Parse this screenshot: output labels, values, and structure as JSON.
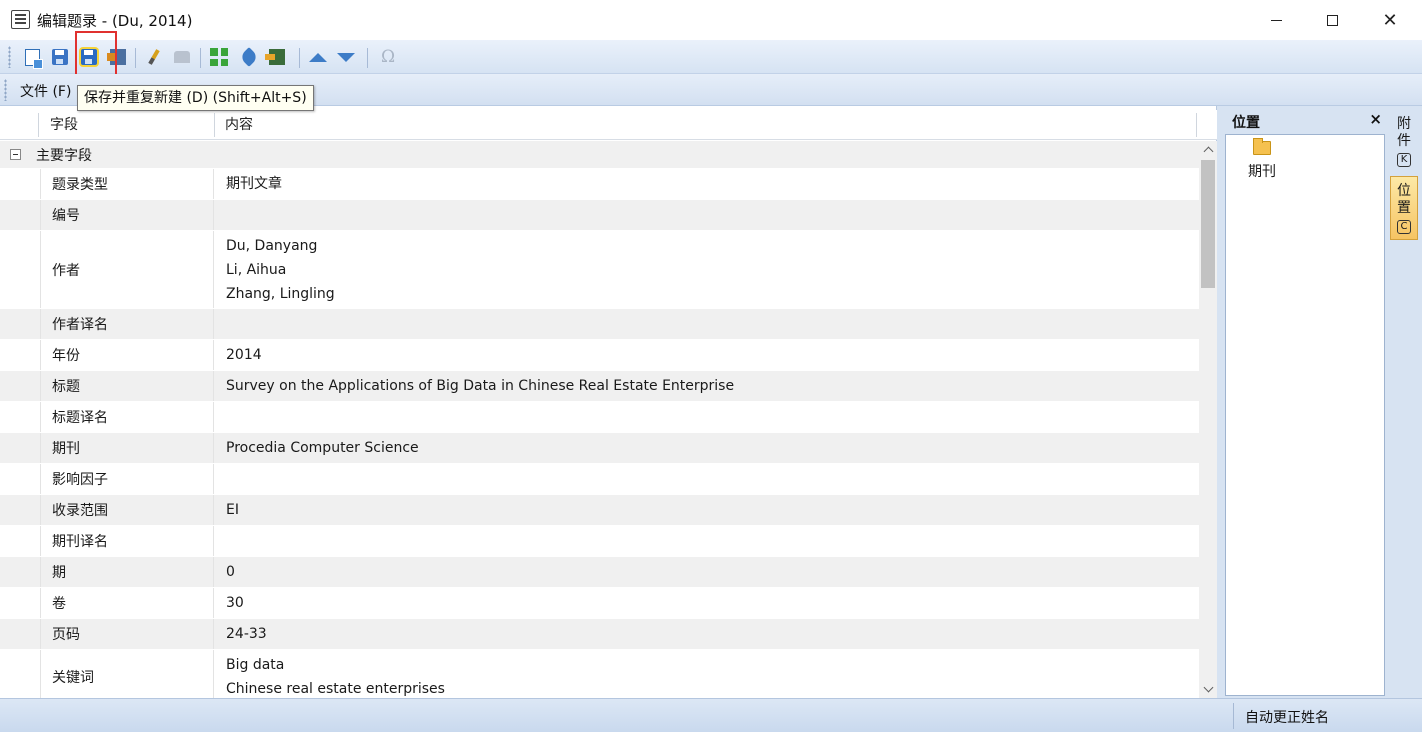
{
  "window": {
    "title": "编辑题录 - (Du, 2014)",
    "minimize_glyph": "",
    "maximize_glyph": "",
    "close_glyph": "✕"
  },
  "toolbar": {
    "buttons": [
      {
        "name": "new-record",
        "icon": "new-document-icon"
      },
      {
        "name": "save",
        "icon": "save-icon"
      },
      {
        "name": "save-and-repeat-new",
        "icon": "save-new-icon",
        "highlighted": true
      },
      {
        "name": "save-and-close",
        "icon": "save-close-icon"
      },
      {
        "name": "clean",
        "icon": "brush-icon"
      },
      {
        "name": "stamp",
        "icon": "stamp-icon",
        "disabled": true
      },
      {
        "name": "fields",
        "icon": "grid-icon"
      },
      {
        "name": "pin",
        "icon": "pin-icon"
      },
      {
        "name": "export",
        "icon": "export-icon"
      },
      {
        "name": "move-up",
        "icon": "arrow-up-icon"
      },
      {
        "name": "move-down",
        "icon": "arrow-down-icon"
      },
      {
        "name": "symbol",
        "icon": "omega-icon",
        "disabled": true
      }
    ],
    "omega": "Ω",
    "tooltip": "保存并重复新建 (D) (Shift+Alt+S)",
    "highlight_color": "#e0312f"
  },
  "menu": {
    "file": "文件 (F)"
  },
  "grid": {
    "headers": {
      "field": "字段",
      "content": "内容"
    },
    "group": "主要字段",
    "rows": [
      {
        "field": "题录类型",
        "value": [
          "期刊文章"
        ]
      },
      {
        "field": "编号",
        "value": []
      },
      {
        "field": "作者",
        "value": [
          "Du, Danyang",
          "Li, Aihua",
          "Zhang, Lingling"
        ]
      },
      {
        "field": "作者译名",
        "value": []
      },
      {
        "field": "年份",
        "value": [
          "2014"
        ]
      },
      {
        "field": "标题",
        "value": [
          "Survey on the Applications of Big Data in Chinese Real Estate Enterprise"
        ]
      },
      {
        "field": "标题译名",
        "value": []
      },
      {
        "field": "期刊",
        "value": [
          "Procedia Computer Science"
        ]
      },
      {
        "field": "影响因子",
        "value": []
      },
      {
        "field": "收录范围",
        "value": [
          "EI"
        ]
      },
      {
        "field": "期刊译名",
        "value": []
      },
      {
        "field": "期",
        "value": [
          "0"
        ]
      },
      {
        "field": "卷",
        "value": [
          "30"
        ]
      },
      {
        "field": "页码",
        "value": [
          "24-33"
        ]
      },
      {
        "field": "关键词",
        "value": [
          "Big data",
          "Chinese real estate enterprises"
        ]
      }
    ]
  },
  "side_panel": {
    "title": "位置",
    "close": "×",
    "folder_label": "期刊"
  },
  "vertical_tabs": {
    "attachments": {
      "label_1": "附",
      "label_2": "件",
      "key": "K"
    },
    "location": {
      "label_1": "位",
      "label_2": "置",
      "key": "C"
    }
  },
  "status": {
    "auto_correct": "自动更正姓名"
  }
}
